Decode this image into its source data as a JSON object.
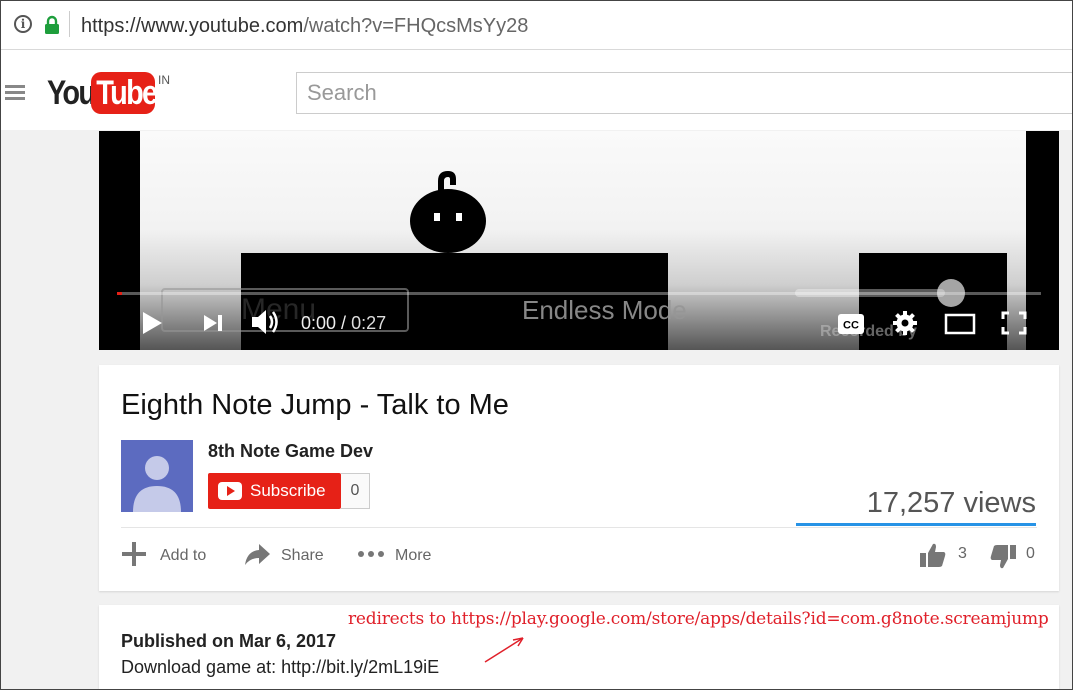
{
  "browser": {
    "url_host": "https://www.youtube.com",
    "url_path": "/watch?v=FHQcsMsYy28"
  },
  "header": {
    "logo_you": "You",
    "logo_tube": "Tube",
    "logo_country": "IN",
    "search_placeholder": "Search"
  },
  "player": {
    "game_menu_text": "Menu",
    "game_mode_text": "Endless Mode",
    "game_watermark": "Recorded by",
    "current_time": "0:00",
    "time_separator": " / ",
    "duration": "0:27",
    "progress_fraction": 0.005
  },
  "video": {
    "title": "Eighth Note Jump - Talk to Me",
    "channel_name": "8th Note Game Dev",
    "subscribe_label": "Subscribe",
    "subscriber_count": "0",
    "views": "17,257 views",
    "add_to_label": "Add to",
    "share_label": "Share",
    "more_label": "More",
    "like_count": "3",
    "dislike_count": "0"
  },
  "description": {
    "published": "Published on Mar 6, 2017",
    "download_text": "Download game at: http://bit.ly/2mL19iE"
  },
  "annotation": {
    "text": "redirects to https://play.google.com/store/apps/details?id=com.g8note.screamjump",
    "color": "#e0202a"
  },
  "colors": {
    "brand_red": "#e62117",
    "like_bar": "#2793e6"
  }
}
